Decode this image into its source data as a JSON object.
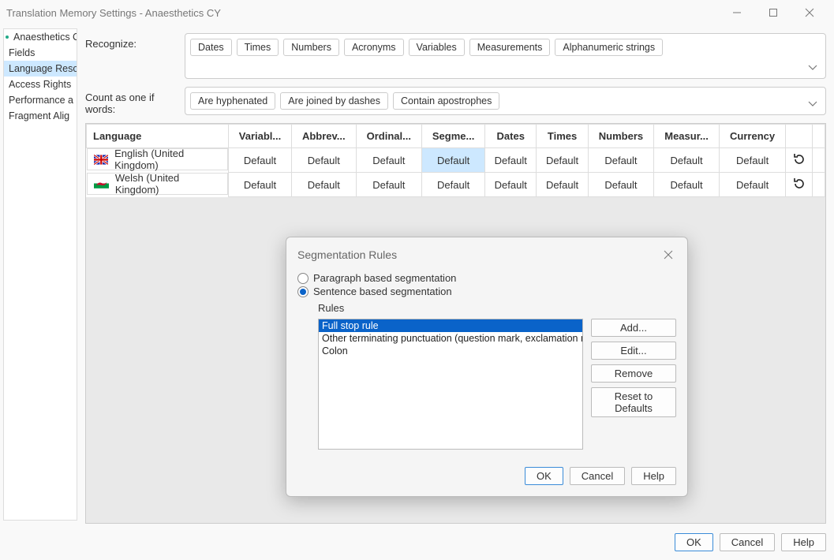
{
  "window": {
    "title": "Translation Memory Settings - Anaesthetics CY"
  },
  "sidebar": {
    "items": [
      {
        "label": "Anaesthetics C"
      },
      {
        "label": "Fields"
      },
      {
        "label": "Language Reso"
      },
      {
        "label": "Access Rights"
      },
      {
        "label": "Performance a"
      },
      {
        "label": "Fragment Alig"
      }
    ]
  },
  "form": {
    "recognize_label": "Recognize:",
    "recognize_tokens": [
      "Dates",
      "Times",
      "Numbers",
      "Acronyms",
      "Variables",
      "Measurements",
      "Alphanumeric strings"
    ],
    "count_label": "Count as one if words:",
    "count_tokens": [
      "Are hyphenated",
      "Are joined by dashes",
      "Contain apostrophes"
    ]
  },
  "grid": {
    "headers": [
      "Language",
      "Variabl...",
      "Abbrev...",
      "Ordinal...",
      "Segme...",
      "Dates",
      "Times",
      "Numbers",
      "Measur...",
      "Currency"
    ],
    "rows": [
      {
        "lang": "English (United Kingdom)",
        "flag": "uk",
        "cells": [
          "Default",
          "Default",
          "Default",
          "Default",
          "Default",
          "Default",
          "Default",
          "Default",
          "Default"
        ],
        "sel_col": 3
      },
      {
        "lang": "Welsh (United Kingdom)",
        "flag": "wales",
        "cells": [
          "Default",
          "Default",
          "Default",
          "Default",
          "Default",
          "Default",
          "Default",
          "Default",
          "Default"
        ],
        "sel_col": -1
      }
    ]
  },
  "modal": {
    "title": "Segmentation Rules",
    "radio1": "Paragraph based segmentation",
    "radio2": "Sentence based segmentation",
    "rules_label": "Rules",
    "rules": [
      "Full stop rule",
      "Other terminating punctuation (question mark, exclamation mark)",
      "Colon"
    ],
    "btns": {
      "add": "Add...",
      "edit": "Edit...",
      "remove": "Remove",
      "reset": "Reset to Defaults"
    },
    "footer": {
      "ok": "OK",
      "cancel": "Cancel",
      "help": "Help"
    }
  },
  "footer": {
    "ok": "OK",
    "cancel": "Cancel",
    "help": "Help"
  }
}
